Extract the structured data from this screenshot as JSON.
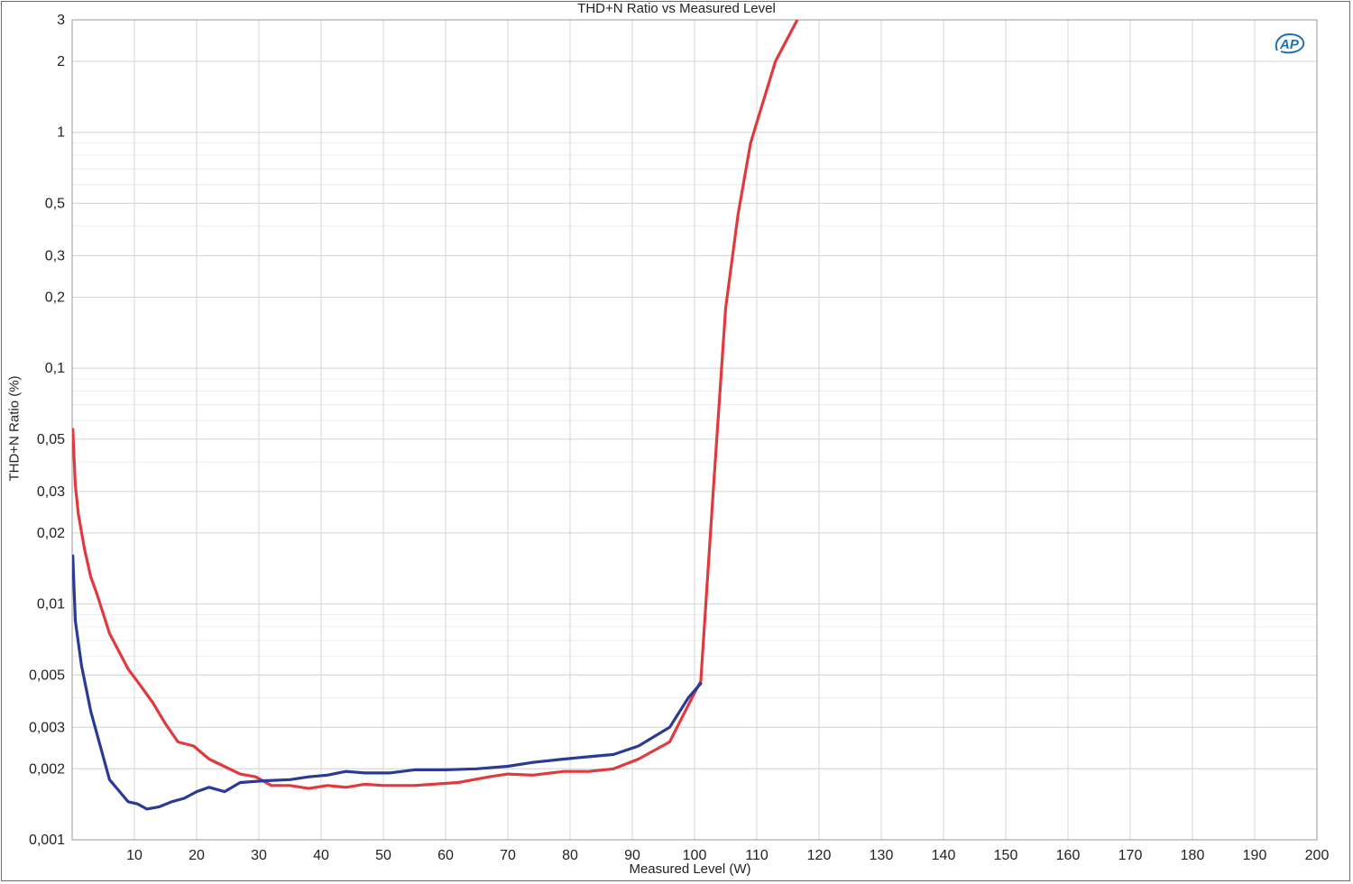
{
  "chart_data": {
    "type": "line",
    "title": "THD+N Ratio vs Measured Level",
    "xlabel": "Measured Level (W)",
    "ylabel": "THD+N Ratio (%)",
    "xlim": [
      0,
      200
    ],
    "ylim": [
      0.001,
      3
    ],
    "yscale": "log",
    "grid": true,
    "x_ticks": [
      10,
      20,
      30,
      40,
      50,
      60,
      70,
      80,
      90,
      100,
      110,
      120,
      130,
      140,
      150,
      160,
      170,
      180,
      190,
      200
    ],
    "y_ticks": [
      {
        "value": 0.001,
        "label": "0,001"
      },
      {
        "value": 0.002,
        "label": "0,002"
      },
      {
        "value": 0.003,
        "label": "0,003"
      },
      {
        "value": 0.005,
        "label": "0,005"
      },
      {
        "value": 0.01,
        "label": "0,01"
      },
      {
        "value": 0.02,
        "label": "0,02"
      },
      {
        "value": 0.03,
        "label": "0,03"
      },
      {
        "value": 0.05,
        "label": "0,05"
      },
      {
        "value": 0.1,
        "label": "0,1"
      },
      {
        "value": 0.2,
        "label": "0,2"
      },
      {
        "value": 0.3,
        "label": "0,3"
      },
      {
        "value": 0.5,
        "label": "0,5"
      },
      {
        "value": 1,
        "label": "1"
      },
      {
        "value": 2,
        "label": "2"
      },
      {
        "value": 3,
        "label": "3"
      }
    ],
    "series": [
      {
        "color": "#e03a3e",
        "points": [
          [
            0.1,
            0.055
          ],
          [
            0.5,
            0.032
          ],
          [
            1,
            0.024
          ],
          [
            2,
            0.017
          ],
          [
            3,
            0.013
          ],
          [
            4,
            0.011
          ],
          [
            6,
            0.0075
          ],
          [
            9,
            0.0053
          ],
          [
            11,
            0.0045
          ],
          [
            13,
            0.0038
          ],
          [
            15,
            0.0031
          ],
          [
            17,
            0.0026
          ],
          [
            19.5,
            0.0025
          ],
          [
            22,
            0.0022
          ],
          [
            27,
            0.0019
          ],
          [
            29.5,
            0.00185
          ],
          [
            32,
            0.0017
          ],
          [
            35,
            0.0017
          ],
          [
            38,
            0.00165
          ],
          [
            41,
            0.0017
          ],
          [
            44,
            0.00167
          ],
          [
            47,
            0.00172
          ],
          [
            50,
            0.0017
          ],
          [
            55,
            0.0017
          ],
          [
            62,
            0.00175
          ],
          [
            67,
            0.00185
          ],
          [
            70,
            0.0019
          ],
          [
            74,
            0.00188
          ],
          [
            79,
            0.00195
          ],
          [
            83,
            0.00195
          ],
          [
            87,
            0.002
          ],
          [
            91,
            0.0022
          ],
          [
            96,
            0.0026
          ],
          [
            100,
            0.0042
          ],
          [
            101,
            0.0047
          ],
          [
            103,
            0.03
          ],
          [
            105,
            0.18
          ],
          [
            107,
            0.45
          ],
          [
            109,
            0.9
          ],
          [
            110,
            1.1
          ],
          [
            113,
            2.0
          ],
          [
            116.5,
            3.0
          ]
        ]
      },
      {
        "color": "#2b3a97",
        "points": [
          [
            0.1,
            0.016
          ],
          [
            0.5,
            0.0085
          ],
          [
            1.5,
            0.0055
          ],
          [
            3,
            0.0035
          ],
          [
            4,
            0.0028
          ],
          [
            6,
            0.0018
          ],
          [
            9,
            0.00145
          ],
          [
            10.5,
            0.00142
          ],
          [
            12,
            0.00135
          ],
          [
            14,
            0.00138
          ],
          [
            16,
            0.00145
          ],
          [
            18,
            0.0015
          ],
          [
            20,
            0.0016
          ],
          [
            22,
            0.00167
          ],
          [
            24.5,
            0.0016
          ],
          [
            27,
            0.00175
          ],
          [
            31,
            0.00178
          ],
          [
            35,
            0.0018
          ],
          [
            38,
            0.00185
          ],
          [
            41,
            0.00188
          ],
          [
            44,
            0.00195
          ],
          [
            47,
            0.00192
          ],
          [
            51,
            0.00192
          ],
          [
            55,
            0.00198
          ],
          [
            60,
            0.00198
          ],
          [
            65,
            0.002
          ],
          [
            70,
            0.00205
          ],
          [
            74,
            0.00213
          ],
          [
            79,
            0.0022
          ],
          [
            83,
            0.00225
          ],
          [
            87,
            0.0023
          ],
          [
            91,
            0.0025
          ],
          [
            96,
            0.003
          ],
          [
            99,
            0.004
          ],
          [
            101,
            0.0046
          ]
        ]
      }
    ]
  },
  "logo": {
    "text": "AP",
    "color": "#1d6fb8"
  }
}
